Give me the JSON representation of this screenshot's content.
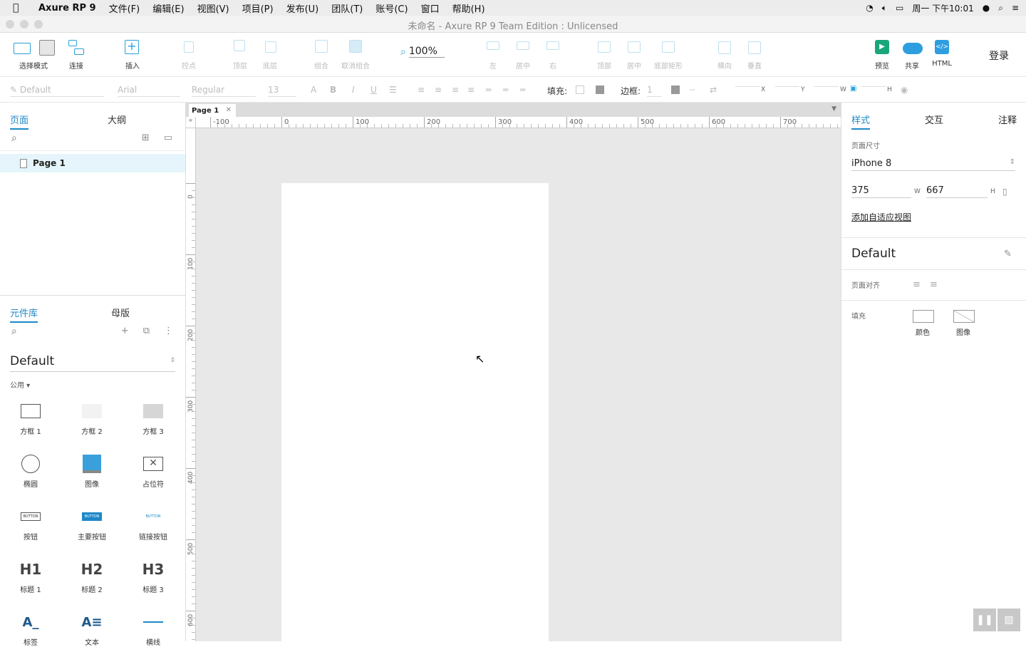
{
  "menubar": {
    "app": "Axure RP 9",
    "menus": [
      "文件(F)",
      "编辑(E)",
      "视图(V)",
      "项目(P)",
      "发布(U)",
      "团队(T)",
      "账号(C)",
      "窗口",
      "帮助(H)"
    ],
    "clock": "周一 下午10:01"
  },
  "window": {
    "title": "未命名 - Axure RP 9 Team Edition : Unlicensed"
  },
  "toolbar": {
    "select_mode": "选择模式",
    "connect": "连接",
    "insert": "插入",
    "point": "控点",
    "top": "顶层",
    "bottom": "底层",
    "group": "组合",
    "ungroup": "取消组合",
    "zoom": "100%",
    "left": "左",
    "center": "居中",
    "right": "右",
    "top_align": "顶部",
    "middle": "居中",
    "bottom_rect": "底部矩形",
    "horizontal": "横向",
    "vertical": "垂直",
    "preview": "预览",
    "share": "共享",
    "html": "HTML",
    "login": "登录"
  },
  "formatbar": {
    "style": "Default",
    "font": "Arial",
    "weight": "Regular",
    "size": "13",
    "fill_label": "填充:",
    "border_label": "边框:",
    "border_value": "1",
    "x": "X",
    "y": "Y",
    "w": "W",
    "h": "H"
  },
  "leftpanel": {
    "tabs": [
      "页面",
      "大纲"
    ],
    "pages": [
      "Page 1"
    ],
    "lib_tabs": [
      "元件库",
      "母版"
    ],
    "library": "Default",
    "group": "公用 ▾",
    "widgets": [
      "方框 1",
      "方框 2",
      "方框 3",
      "椭圆",
      "图像",
      "占位符",
      "按钮",
      "主要按钮",
      "链接按钮",
      "标题 1",
      "标题 2",
      "标题 3",
      "标签",
      "文本",
      "横线"
    ],
    "widget_glyphs": {
      "h1": "H1",
      "h2": "H2",
      "h3": "H3",
      "button": "BUTTON"
    }
  },
  "canvas": {
    "tab": "Page 1",
    "hticks": [
      "-100",
      "0",
      "100",
      "200",
      "300",
      "400",
      "500",
      "600",
      "700"
    ],
    "vticks": [
      "0",
      "100",
      "200",
      "300",
      "400",
      "500",
      "600"
    ]
  },
  "rightpanel": {
    "tabs": [
      "样式",
      "交互",
      "注释"
    ],
    "page_size_label": "页面尺寸",
    "device": "iPhone 8",
    "width": "375",
    "w": "W",
    "height": "667",
    "h": "H",
    "add_adaptive": "添加自适应视图",
    "style_name": "Default",
    "page_align": "页面对齐",
    "fill": "填充",
    "fill_color": "颜色",
    "fill_image": "图像"
  },
  "colors": {
    "accent": "#1e88c8",
    "preview": "#1aa67a",
    "share": "#2e9ee0"
  }
}
